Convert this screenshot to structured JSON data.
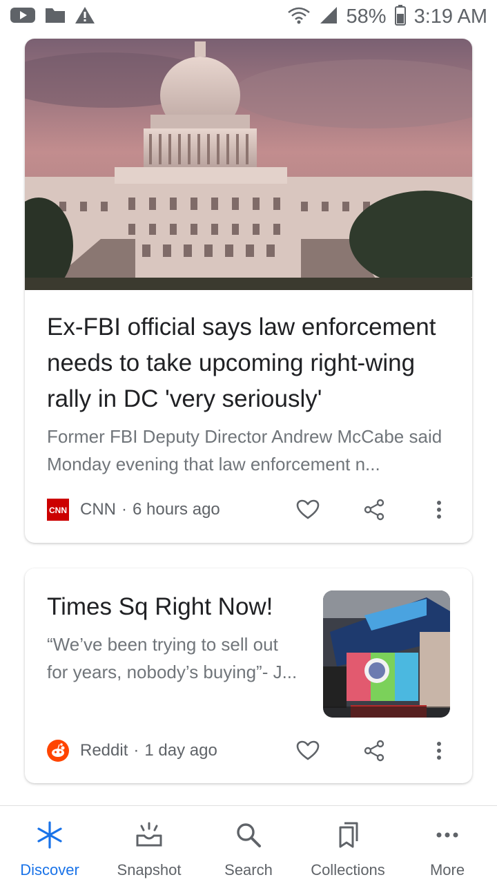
{
  "status_bar": {
    "battery": "58%",
    "time": "3:19 AM",
    "left_icons": [
      "youtube-icon",
      "folder-icon",
      "warning-icon"
    ],
    "right_icons": [
      "wifi-icon",
      "signal-icon",
      "battery-icon"
    ]
  },
  "cards": [
    {
      "headline": "Ex-FBI official says law enforcement needs to take upcoming right-wing rally in DC 'very seriously'",
      "snippet": "Former FBI Deputy Director Andrew McCabe said Monday evening that law enforcement n...",
      "source_logo_text": "CNN",
      "source": "CNN",
      "separator": "·",
      "time": "6 hours ago",
      "source_color": "#cc0000"
    },
    {
      "headline": "Times Sq Right Now!",
      "snippet": "“We’ve been trying to sell out for years, nobody’s buying”- J...",
      "source": "Reddit",
      "separator": "·",
      "time": "1 day ago",
      "source_color": "#ff4500"
    }
  ],
  "bottom_nav": {
    "items": [
      {
        "label": "Discover",
        "icon": "discover-icon",
        "active": true
      },
      {
        "label": "Snapshot",
        "icon": "snapshot-icon",
        "active": false
      },
      {
        "label": "Search",
        "icon": "search-icon",
        "active": false
      },
      {
        "label": "Collections",
        "icon": "collections-icon",
        "active": false
      },
      {
        "label": "More",
        "icon": "more-horiz-icon",
        "active": false
      }
    ]
  },
  "colors": {
    "accent": "#1a73e8",
    "text_primary": "#202124",
    "text_secondary": "#70757a",
    "icon_gray": "#5f6368"
  }
}
